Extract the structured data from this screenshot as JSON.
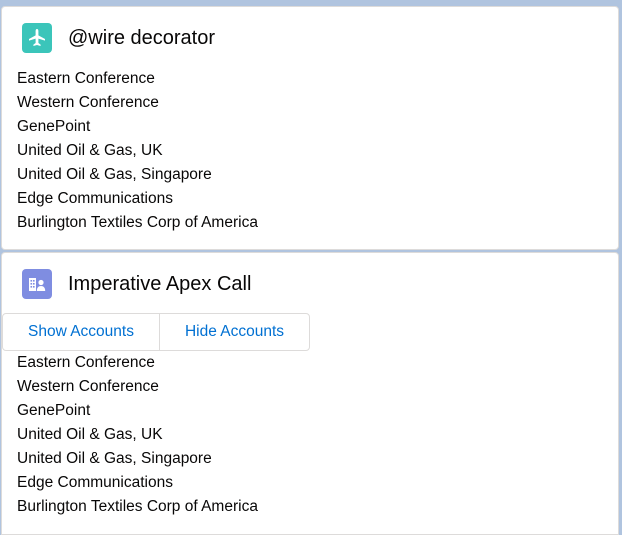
{
  "colors": {
    "background": "#b0c4df",
    "card_background": "#ffffff",
    "wire_icon_bg": "#3bc5ba",
    "apex_icon_bg": "#7f8de1",
    "button_text": "#0070d2"
  },
  "wire_card": {
    "icon": "plane-icon",
    "title": "@wire decorator",
    "accounts": [
      "Eastern Conference",
      "Western Conference",
      "GenePoint",
      "United Oil & Gas, UK",
      "United Oil & Gas, Singapore",
      "Edge Communications",
      "Burlington Textiles Corp of America"
    ]
  },
  "apex_card": {
    "icon": "account-icon",
    "title": "Imperative Apex Call",
    "buttons": {
      "show": "Show Accounts",
      "hide": "Hide Accounts"
    },
    "accounts": [
      "Eastern Conference",
      "Western Conference",
      "GenePoint",
      "United Oil & Gas, UK",
      "United Oil & Gas, Singapore",
      "Edge Communications",
      "Burlington Textiles Corp of America"
    ]
  }
}
